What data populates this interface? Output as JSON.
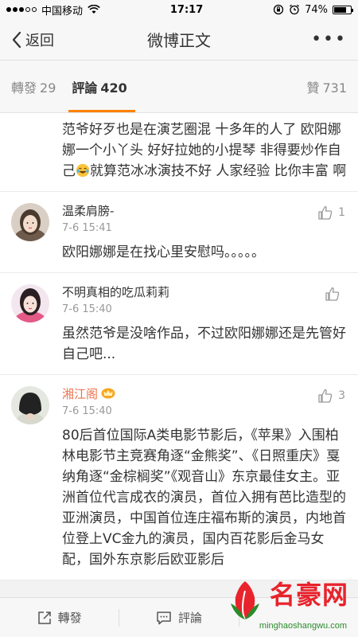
{
  "status_bar": {
    "carrier": "中国移动",
    "time": "17:17",
    "battery": "74%",
    "battery_level": 0.74,
    "icons": [
      "signal-dots",
      "wifi-icon",
      "rotation-lock-icon",
      "alarm-icon",
      "battery-icon"
    ]
  },
  "nav": {
    "back_label": "返回",
    "title": "微博正文",
    "more_label": "•••"
  },
  "tabs": {
    "repost_label": "轉發",
    "repost_count": "29",
    "comment_label": "評論",
    "comment_count": "420",
    "like_label": "贊",
    "like_count": "731"
  },
  "comments": [
    {
      "text_before_emoji": "范爷好歹也是在演艺圈混 十多年的人了 欧阳娜娜一个小丫头 好好拉她的小提琴 非得要炒作自己",
      "emoji": "laughing-tears-emoji",
      "text_after_emoji": "就算范冰冰演技不好 人家经验 比你丰富 啊"
    },
    {
      "name": "温柔肩膀-",
      "time": "7-6 15:41",
      "likes": "1",
      "text": "欧阳娜娜是在找心里安慰吗。。。。。"
    },
    {
      "name": "不明真相的吃瓜莉莉",
      "time": "7-6 15:40",
      "likes": "",
      "text": "虽然范爷是没啥作品，不过欧阳娜娜还是先管好自己吧..."
    },
    {
      "name": "湘江阁",
      "time": "7-6 15:40",
      "likes": "3",
      "vip_badge": "crown-icon",
      "text": "80后首位国际A类电影节影后，《苹果》入围柏林电影节主竞赛角逐“金熊奖”、《日照重庆》戛纳角逐“金棕榈奖”《观音山》东京最佳女主。亚洲首位代言成衣的演员，首位入拥有芭比造型的亚洲演员，中国首位连庄福布斯的演员，内地首位登上VC金九的演员，国内百花影后金马女配，国外东京影后欧亚影后"
    }
  ],
  "toolbar": {
    "repost_label": "轉發",
    "comment_label": "評論"
  },
  "watermark": {
    "brand": "名豪网",
    "url": "minghaoshangwu.com"
  },
  "colors": {
    "accent": "#ff8200",
    "vip_name": "#eb7350",
    "watermark_red": "#e8232c",
    "watermark_green": "#2a8b2a"
  }
}
